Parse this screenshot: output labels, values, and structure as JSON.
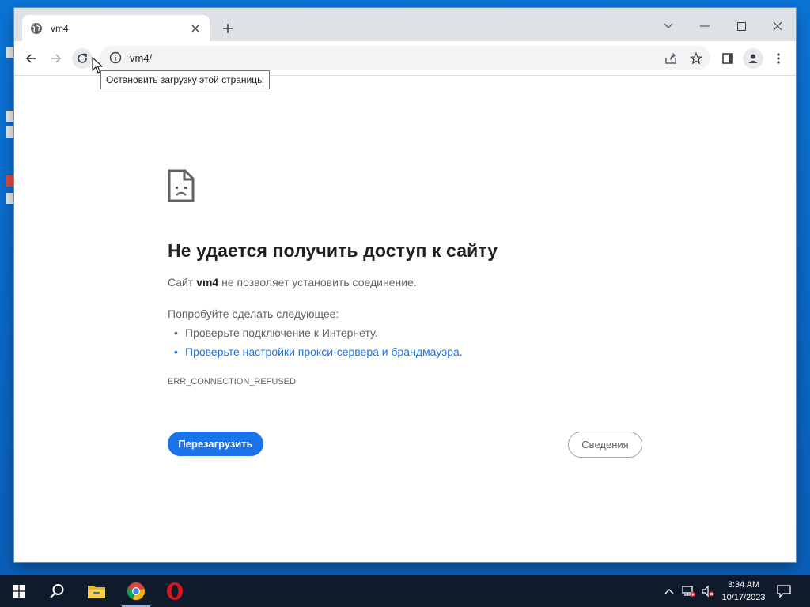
{
  "browser": {
    "tab": {
      "title": "vm4",
      "favicon": "globe-icon"
    },
    "address": {
      "url": "vm4/"
    },
    "tooltip": "Остановить загрузку этой страницы"
  },
  "error_page": {
    "icon": "sad-page-icon",
    "title": "Не удается получить доступ к сайту",
    "message": {
      "prefix": "Сайт",
      "host": "vm4",
      "suffix": "не позволяет установить соединение."
    },
    "try_heading": "Попробуйте сделать следующее:",
    "suggestions": [
      {
        "text": "Проверьте подключение к Интернету.",
        "link": false
      },
      {
        "text": "Проверьте настройки прокси-сервера и брандмауэра",
        "link": true,
        "tail": "."
      }
    ],
    "error_code": "ERR_CONNECTION_REFUSED",
    "reload_label": "Перезагрузить",
    "details_label": "Сведения"
  },
  "taskbar": {
    "apps": [
      "windows-start-icon",
      "search-icon",
      "file-explorer-icon",
      "chrome-icon",
      "opera-icon"
    ],
    "clock": {
      "time": "3:34 AM",
      "date": "10/17/2023"
    }
  },
  "colors": {
    "accent": "#1a73e8",
    "desktop": "#0a6fd0",
    "taskbar": "#0f1a2a"
  }
}
